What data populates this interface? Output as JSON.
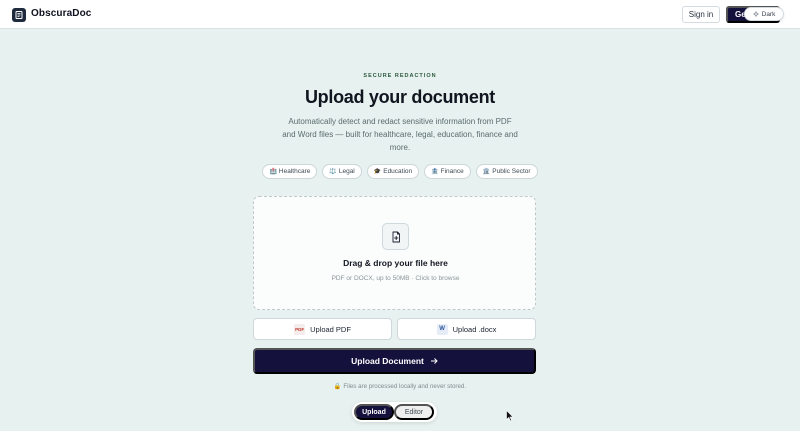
{
  "header": {
    "brand": "ObscuraDoc",
    "signin_label": "Sign in",
    "getstarted_label": "Get started",
    "dark_toggle_label": "Dark"
  },
  "hero": {
    "eyebrow": "SECURE REDACTION",
    "title": "Upload your document",
    "subtitle": "Automatically detect and redact sensitive information from PDF and Word files — built for healthcare, legal, education, finance and more."
  },
  "chips": [
    {
      "icon": "🏥",
      "label": "Healthcare"
    },
    {
      "icon": "⚖️",
      "label": "Legal"
    },
    {
      "icon": "🎓",
      "label": "Education"
    },
    {
      "icon": "🏦",
      "label": "Finance"
    },
    {
      "icon": "🏛️",
      "label": "Public Sector"
    }
  ],
  "dropzone": {
    "title": "Drag & drop your file here",
    "subtitle": "PDF or DOCX, up to 50MB · Click to browse"
  },
  "upload_options": {
    "pdf_badge": "PDF",
    "pdf_label": "Upload PDF",
    "docx_badge": "W",
    "docx_label": "Upload .docx"
  },
  "primary_button": {
    "label": "Upload Document"
  },
  "note": "🔒 Files are processed locally and never stored.",
  "segmented": {
    "upload_label": "Upload",
    "editor_label": "Editor"
  },
  "colors": {
    "accent": "#14113d",
    "background": "#e7f1ef",
    "eyebrow": "#2d5a40"
  }
}
